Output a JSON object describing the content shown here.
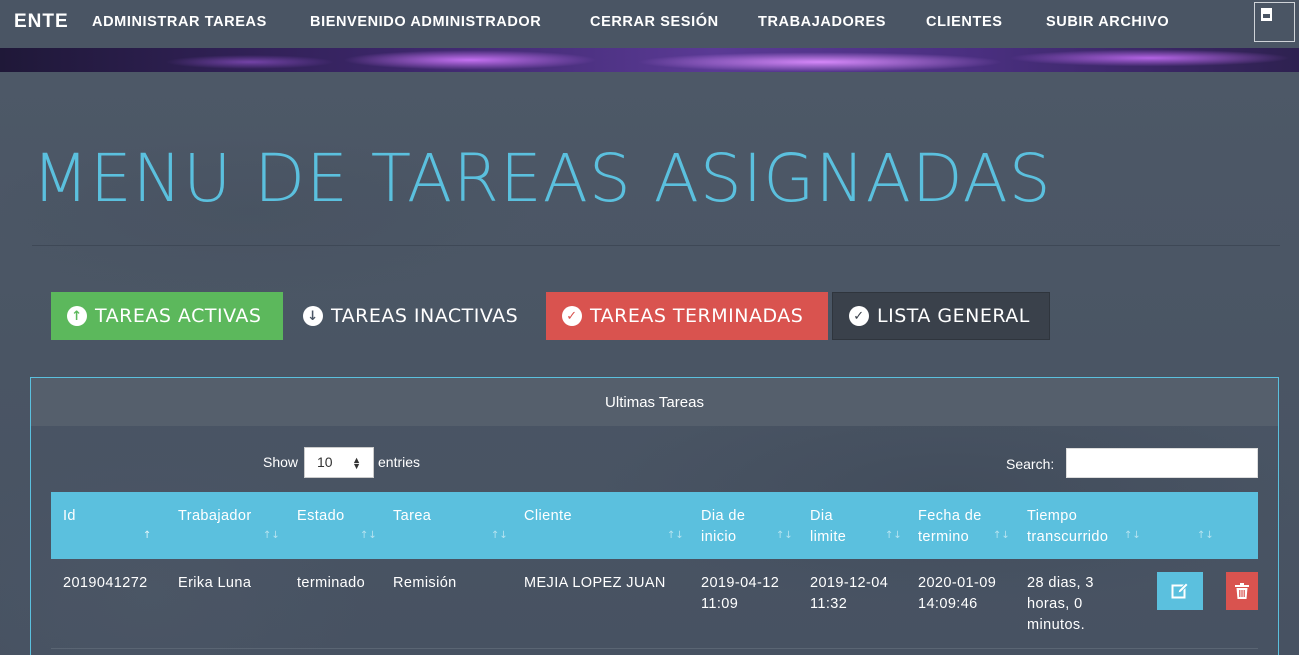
{
  "nav": {
    "brand": "ENTE",
    "items": [
      {
        "label": "ADMINISTRAR TAREAS"
      },
      {
        "label": "BIENVENIDO ADMINISTRADOR"
      },
      {
        "label": "CERRAR SESIÓN"
      },
      {
        "label": "TRABAJADORES"
      },
      {
        "label": "CLIENTES"
      },
      {
        "label": "SUBIR ARCHIVO"
      }
    ],
    "file_icon": "broken-image-icon"
  },
  "page_title": "MENU DE TAREAS ASIGNADAS",
  "filter_buttons": [
    {
      "label": "TAREAS ACTIVAS",
      "icon": "arrow-up-circle-icon",
      "color": "#5cb85c"
    },
    {
      "label": "TAREAS INACTIVAS",
      "icon": "arrow-down-circle-icon",
      "color": "transparent"
    },
    {
      "label": "TAREAS TERMINADAS",
      "icon": "check-circle-icon",
      "color": "#d9534f"
    },
    {
      "label": "LISTA GENERAL",
      "icon": "check-circle-icon",
      "color": "#3a414b"
    }
  ],
  "panel": {
    "heading": "Ultimas Tareas",
    "show_label": "Show",
    "length_value": "10",
    "entries_label": "entries",
    "search_label": "Search:",
    "search_value": ""
  },
  "table": {
    "columns": [
      {
        "label": "Id"
      },
      {
        "label": "Trabajador"
      },
      {
        "label": "Estado"
      },
      {
        "label": "Tarea"
      },
      {
        "label": "Cliente"
      },
      {
        "label": "Dia de\ninicio"
      },
      {
        "label": "Dia\nlimite"
      },
      {
        "label": "Fecha de\ntermino"
      },
      {
        "label": "Tiempo\ntranscurrido"
      }
    ],
    "rows": [
      {
        "id": "2019041272",
        "trabajador": "Erika Luna",
        "estado": "terminado",
        "tarea": "Remisión",
        "cliente": "MEJIA LOPEZ JUAN",
        "inicio": "2019-04-12\n11:09",
        "limite": "2019-12-04\n11:32",
        "termino": "2020-01-09\n14:09:46",
        "transcurrido": "28 dias, 3\nhoras, 0\nminutos."
      }
    ]
  },
  "colors": {
    "accent": "#5bc0de",
    "success": "#5cb85c",
    "danger": "#d9534f",
    "dark": "#3a414b",
    "background": "#4b5665"
  }
}
